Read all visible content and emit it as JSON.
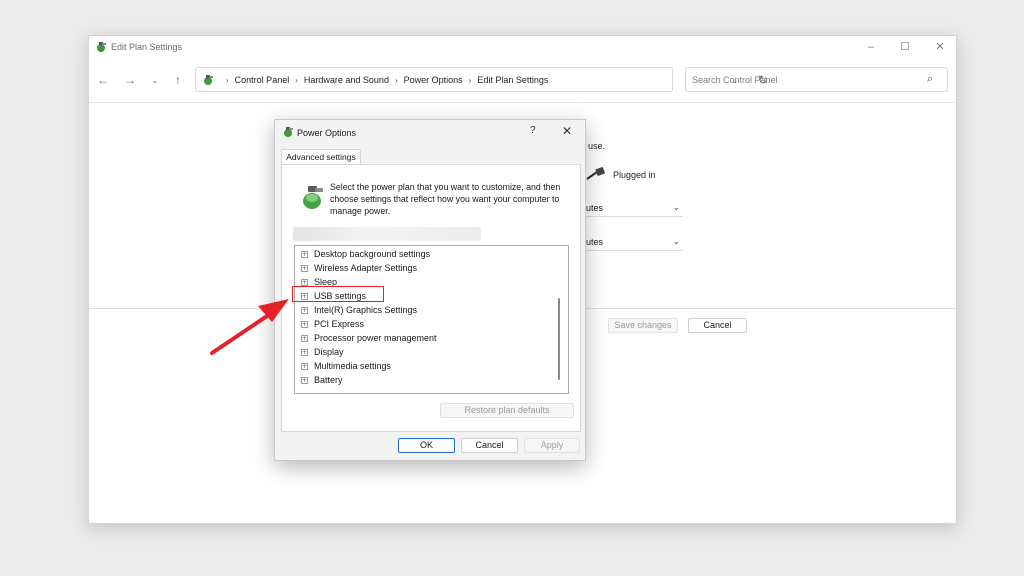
{
  "window": {
    "title": "Edit Plan Settings",
    "controls": {
      "minimize": "–",
      "maximize": "☐",
      "close": "✕"
    }
  },
  "nav": {
    "back": "←",
    "forward": "→",
    "recent": "⌄",
    "up": "↑",
    "breadcrumbs": [
      "Control Panel",
      "Hardware and Sound",
      "Power Options",
      "Edit Plan Settings"
    ],
    "separator": "›",
    "dropdown": "⌄",
    "refresh": "↻"
  },
  "search": {
    "placeholder": "Search Control Panel",
    "icon": "⌕"
  },
  "background": {
    "use_fragment": "use.",
    "plugged_in": "Plugged in",
    "select1": "inutes",
    "select2": "inutes",
    "chevron": "⌄",
    "save_changes": "Save changes",
    "cancel": "Cancel"
  },
  "dialog": {
    "title": "Power Options",
    "help": "?",
    "close": "✕",
    "tab": "Advanced settings",
    "description": "Select the power plan that you want to customize, and then choose settings that reflect how you want your computer to manage power.",
    "tree_items": [
      "Desktop background settings",
      "Wireless Adapter Settings",
      "Sleep",
      "USB settings",
      "Intel(R) Graphics Settings",
      "PCI Express",
      "Processor power management",
      "Display",
      "Multimedia settings",
      "Battery"
    ],
    "expander": "+",
    "restore_defaults": "Restore plan defaults",
    "ok": "OK",
    "cancel": "Cancel",
    "apply": "Apply"
  },
  "colors": {
    "highlight": "#e5222a",
    "ok_border": "#1f6dd2"
  }
}
